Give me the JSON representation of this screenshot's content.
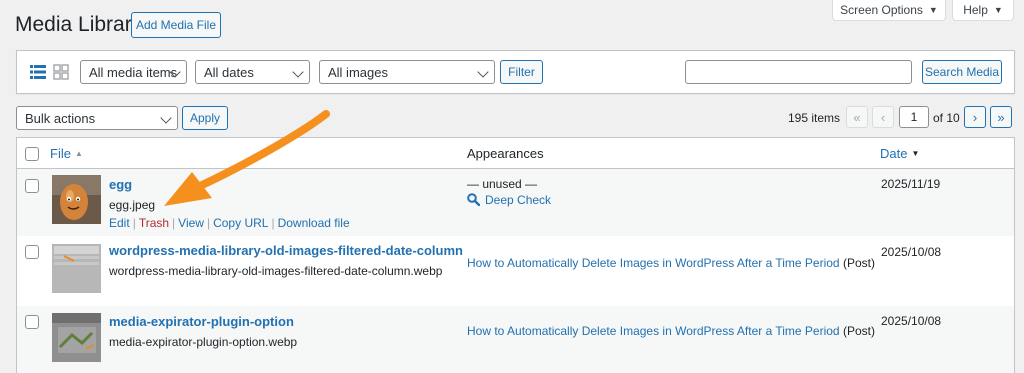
{
  "header": {
    "title": "Media Library",
    "add_button": "Add Media File",
    "screen_options": "Screen Options",
    "help": "Help"
  },
  "filters": {
    "media_type": "All media items",
    "dates": "All dates",
    "images": "All images",
    "filter_button": "Filter",
    "search_value": "",
    "search_button": "Search Media"
  },
  "bulk": {
    "action": "Bulk actions",
    "apply": "Apply"
  },
  "pagination": {
    "items": "195 items",
    "first": "«",
    "prev": "‹",
    "current": "1",
    "of": "of 10",
    "next": "›",
    "last": "»"
  },
  "table": {
    "columns": {
      "file": "File",
      "appearances": "Appearances",
      "date": "Date"
    },
    "rows": [
      {
        "title": "egg",
        "filename": "egg.jpeg",
        "actions": {
          "edit": "Edit",
          "trash": "Trash",
          "view": "View",
          "copy": "Copy URL",
          "download": "Download file"
        },
        "appearance_status": "— unused —",
        "appearance_link": "Deep Check",
        "date": "2025/11/19"
      },
      {
        "title": "wordpress-media-library-old-images-filtered-date-column",
        "filename": "wordpress-media-library-old-images-filtered-date-column.webp",
        "appearance_link": "How to Automatically Delete Images in WordPress After a Time Period",
        "appearance_suffix": "(Post)",
        "date": "2025/10/08"
      },
      {
        "title": "media-expirator-plugin-option",
        "filename": "media-expirator-plugin-option.webp",
        "appearance_link": "How to Automatically Delete Images in WordPress After a Time Period",
        "appearance_suffix": "(Post)",
        "date": "2025/10/08"
      }
    ]
  },
  "colors": {
    "accent": "#2271b1",
    "trash": "#b32d2e",
    "annotation_arrow": "#f5901e"
  },
  "icons": [
    "list-view-icon",
    "grid-view-icon",
    "sort-icon",
    "magnifier-icon",
    "arrow-annotation"
  ]
}
